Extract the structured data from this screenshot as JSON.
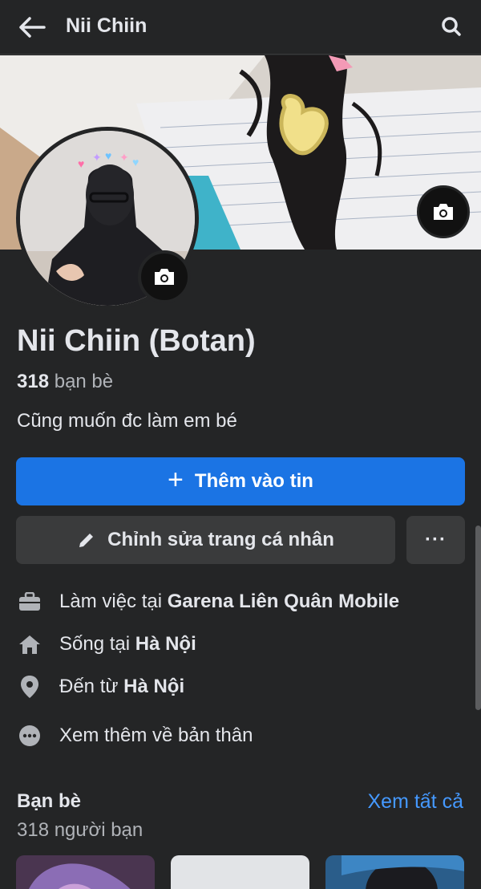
{
  "topbar": {
    "title": "Nii Chiin"
  },
  "profile": {
    "display_name": "Nii Chiin (Botan)",
    "friends_number": "318",
    "friends_word": "bạn bè",
    "bio": "Cũng muốn đc làm em bé"
  },
  "buttons": {
    "add_story": "Thêm vào tin",
    "edit_profile": "Chỉnh sửa trang cá nhân",
    "more": "···"
  },
  "details": [
    {
      "icon": "briefcase-icon",
      "prefix": "Làm việc tại ",
      "value": "Garena Liên Quân Mobile"
    },
    {
      "icon": "home-icon",
      "prefix": "Sống tại ",
      "value": "Hà Nội"
    },
    {
      "icon": "location-pin-icon",
      "prefix": "Đến từ ",
      "value": "Hà Nội"
    },
    {
      "icon": "more-dots-icon",
      "prefix": "Xem thêm về bản thân",
      "value": ""
    }
  ],
  "friends_section": {
    "title": "Bạn bè",
    "count_text": "318 người bạn",
    "see_all": "Xem tất cả"
  },
  "colors": {
    "background": "#242526",
    "primary_button": "#1b74e4",
    "secondary_button": "#3a3b3c",
    "link": "#4599ff",
    "text_primary": "#e4e6eb",
    "text_secondary": "#b0b3b8"
  }
}
